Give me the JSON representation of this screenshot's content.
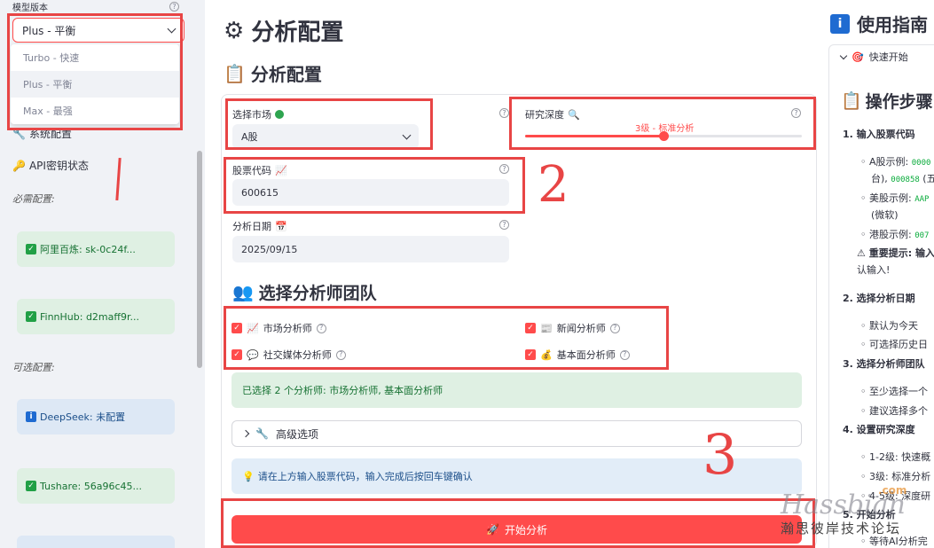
{
  "sidebar": {
    "model_label": "模型版本",
    "model_selected": "Plus - 平衡",
    "model_options": [
      "Turbo - 快速",
      "Plus - 平衡",
      "Max - 最强"
    ],
    "system_config": "系统配置",
    "api_status": "API密钥状态",
    "required_label": "必需配置:",
    "optional_label": "可选配置:",
    "keys": [
      {
        "text": "阿里百炼: sk-0c24f...",
        "status": "ok"
      },
      {
        "text": "FinnHub: d2maff9r...",
        "status": "ok"
      },
      {
        "text": "DeepSeek: 未配置",
        "status": "info"
      },
      {
        "text": "Tushare: 56a96c45...",
        "status": "ok"
      }
    ]
  },
  "main": {
    "title": "分析配置",
    "subtitle": "分析配置",
    "market_label": "选择市场",
    "market_value": "A股",
    "depth_label": "研究深度",
    "depth_value_text": "3级 - 标准分析",
    "depth_level": 3,
    "depth_max": 5,
    "code_label": "股票代码",
    "code_value": "600615",
    "date_label": "分析日期",
    "date_value": "2025/09/15",
    "team_title": "选择分析师团队",
    "analysts": [
      "市场分析师",
      "新闻分析师",
      "社交媒体分析师",
      "基本面分析师"
    ],
    "selected_msg": "已选择 2 个分析师: 市场分析师, 基本面分析师",
    "advanced": "高级选项",
    "hint": "请在上方输入股票代码，输入完成后按回车键确认",
    "submit": "开始分析"
  },
  "annotations": {
    "num2": "2",
    "num3": "3"
  },
  "guide": {
    "title": "使用指南",
    "quick": "快速开始",
    "steps_title": "操作步骤",
    "step1": "1.  输入股票代码",
    "a_example": "A股示例: ",
    "a_code": "0000",
    "a_line2": "台), ",
    "a_code2": "000858",
    "a_line2b": " (五",
    "us_example": "美股示例: ",
    "us_code": "AAP",
    "us_line2": "(微软)",
    "hk_example": "港股示例: ",
    "hk_code": "007",
    "warn": "重要提示: 输入",
    "warn2": "认输入!",
    "step2": "2.  选择分析日期",
    "d1": "默认为今天",
    "d2": "可选择历史日",
    "step3": "3.  选择分析师团队",
    "t1": "至少选择一个",
    "t2": "建议选择多个",
    "step4": "4.  设置研究深度",
    "r1": "1-2级: 快速概",
    "r2": "3级: 标准分析",
    "r3": "4-5级: 深度研",
    "step5": "5.  开始分析",
    "s1": "等待AI分析完"
  },
  "watermark": {
    "line1": "Hassbian",
    "line2": "瀚思彼岸技术论坛",
    "com": ".com"
  }
}
